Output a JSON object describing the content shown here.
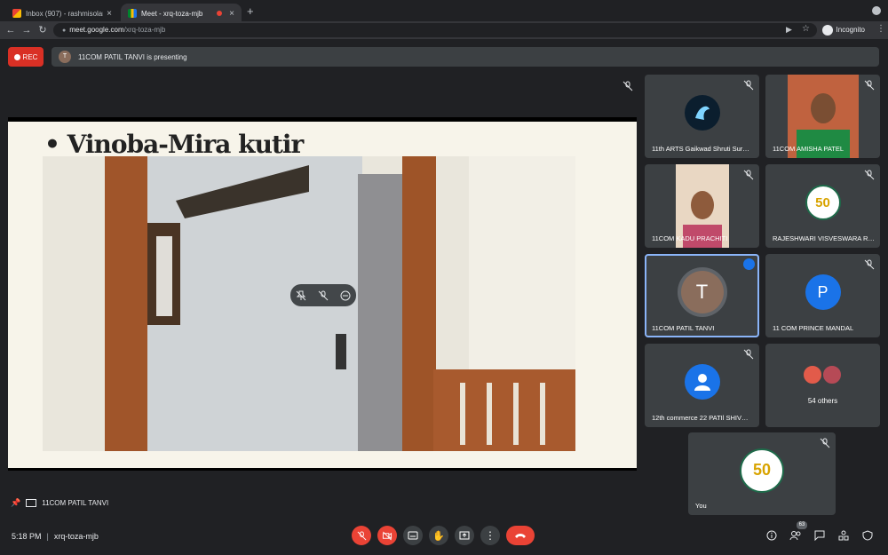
{
  "browser": {
    "tabs": [
      {
        "title": "Inbox (907) - rashmisolanki@…",
        "favicon": "gmail-icon"
      },
      {
        "title": "Meet - xrq-toza-mjb",
        "favicon": "meet-icon"
      }
    ],
    "new_tab": "+",
    "url_host": "meet.google.com",
    "url_path": "/xrq-toza-mjb",
    "incognito_label": "Incognito"
  },
  "meet": {
    "rec_label": "REC",
    "presenter_avatar": "T",
    "presenting_text": "11COM PATIL TANVI is presenting",
    "pinned_name": "11COM PATIL TANVI",
    "slide_title": "• Vinoba-Mira kutir",
    "tiles": [
      {
        "name": "11th ARTS Gaikwad Shruti Sur…"
      },
      {
        "name": "11COM AMISHA PATEL"
      },
      {
        "name": "11COM KADU PRACHITI"
      },
      {
        "name": "RAJESHWARI VISVESWARA R…",
        "logo_text": "50"
      },
      {
        "name": "11COM PATIL TANVI",
        "avatar": "T"
      },
      {
        "name": "11 COM PRINCE MANDAL",
        "avatar": "P"
      },
      {
        "name": "12th commerce 22 PATIl SHIV…"
      },
      {
        "name": "54 others"
      },
      {
        "name": "You",
        "logo_text": "50"
      }
    ],
    "time": "5:18 PM",
    "separator": "|",
    "meeting_code": "xrq-toza-mjb",
    "participants_count": "63"
  },
  "colors": {
    "bg": "#202124",
    "tile": "#3c4043",
    "red": "#ea4335",
    "blue": "#8ab4f8",
    "avatar_t": "#8a6d5c",
    "avatar_p": "#1a73e8"
  }
}
